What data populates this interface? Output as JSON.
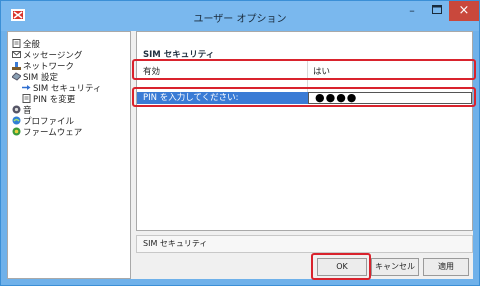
{
  "window": {
    "title": "ユーザー オプション",
    "minimize": "–",
    "close": "×"
  },
  "sidebar": {
    "items": [
      {
        "label": "全般",
        "icon": "page-icon"
      },
      {
        "label": "メッセージング",
        "icon": "message-icon"
      },
      {
        "label": "ネットワーク",
        "icon": "network-icon"
      },
      {
        "label": "SIM 設定",
        "icon": "sim-icon"
      },
      {
        "label": "SIM セキュリティ",
        "icon": "arrow-right-icon"
      },
      {
        "label": "PIN を変更",
        "icon": "page-icon"
      },
      {
        "label": "音",
        "icon": "sound-icon"
      },
      {
        "label": "プロファイル",
        "icon": "profile-icon"
      },
      {
        "label": "ファームウェア",
        "icon": "firmware-icon"
      }
    ]
  },
  "panel": {
    "section_title": "SIM セキュリティ",
    "rows": [
      {
        "key": "有効",
        "value": "はい"
      },
      {
        "key": "PIN を入力してください:",
        "value": "●●●●"
      }
    ]
  },
  "description": "SIM セキュリティ",
  "buttons": {
    "ok": "OK",
    "cancel": "キャンセル",
    "apply": "適用"
  },
  "colors": {
    "titlebar": "#7ab8ee",
    "close": "#c9483c",
    "selection": "#3a7bd5",
    "highlight": "#d9232d"
  }
}
